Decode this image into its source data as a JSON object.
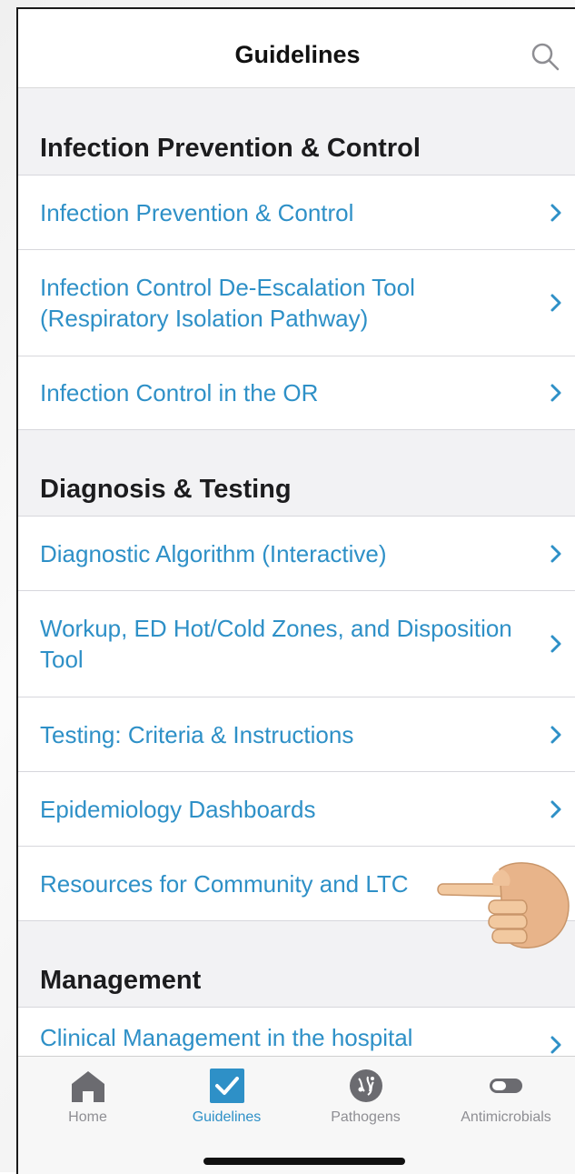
{
  "header": {
    "title": "Guidelines"
  },
  "sections": [
    {
      "title": "Infection Prevention & Control",
      "items": [
        {
          "label": "Infection Prevention & Control"
        },
        {
          "label": "Infection Control De-Escalation Tool (Respiratory Isolation Pathway)"
        },
        {
          "label": "Infection Control in the OR"
        }
      ]
    },
    {
      "title": "Diagnosis & Testing",
      "items": [
        {
          "label": "Diagnostic Algorithm (Interactive)"
        },
        {
          "label": "Workup, ED Hot/Cold Zones, and Disposition Tool"
        },
        {
          "label": "Testing: Criteria & Instructions"
        },
        {
          "label": "Epidemiology Dashboards"
        },
        {
          "label": "Resources for Community and LTC"
        }
      ]
    },
    {
      "title": "Management",
      "items": [
        {
          "label": "Clinical Management in the hospital"
        }
      ]
    }
  ],
  "tabbar": {
    "tabs": [
      {
        "label": "Home",
        "icon": "home-icon"
      },
      {
        "label": "Guidelines",
        "icon": "checkbox-icon",
        "active": true
      },
      {
        "label": "Pathogens",
        "icon": "pathogen-icon"
      },
      {
        "label": "Antimicrobials",
        "icon": "capsule-icon"
      }
    ]
  },
  "colors": {
    "accent": "#2e90c7",
    "inactive": "#8e8e93"
  }
}
